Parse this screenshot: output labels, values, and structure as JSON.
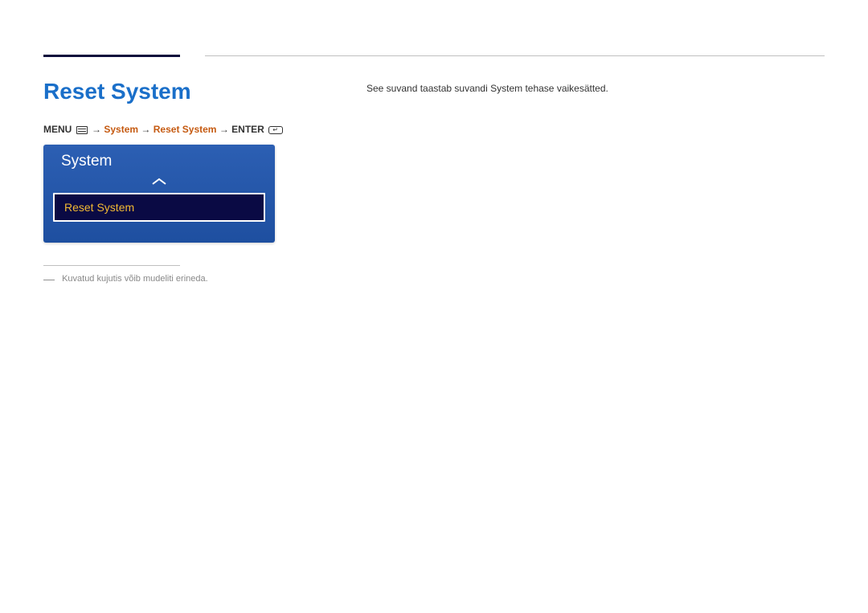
{
  "page": {
    "title": "Reset System",
    "description": "See suvand taastab suvandi System tehase vaikesätted."
  },
  "breadcrumb": {
    "menu_label": "MENU",
    "arrow": " → ",
    "system": "System",
    "reset_system": "Reset System",
    "enter_label": "ENTER"
  },
  "menu": {
    "header": "System",
    "selected_item": "Reset System"
  },
  "footnote": {
    "text": "Kuvatud kujutis võib mudeliti erineda."
  }
}
